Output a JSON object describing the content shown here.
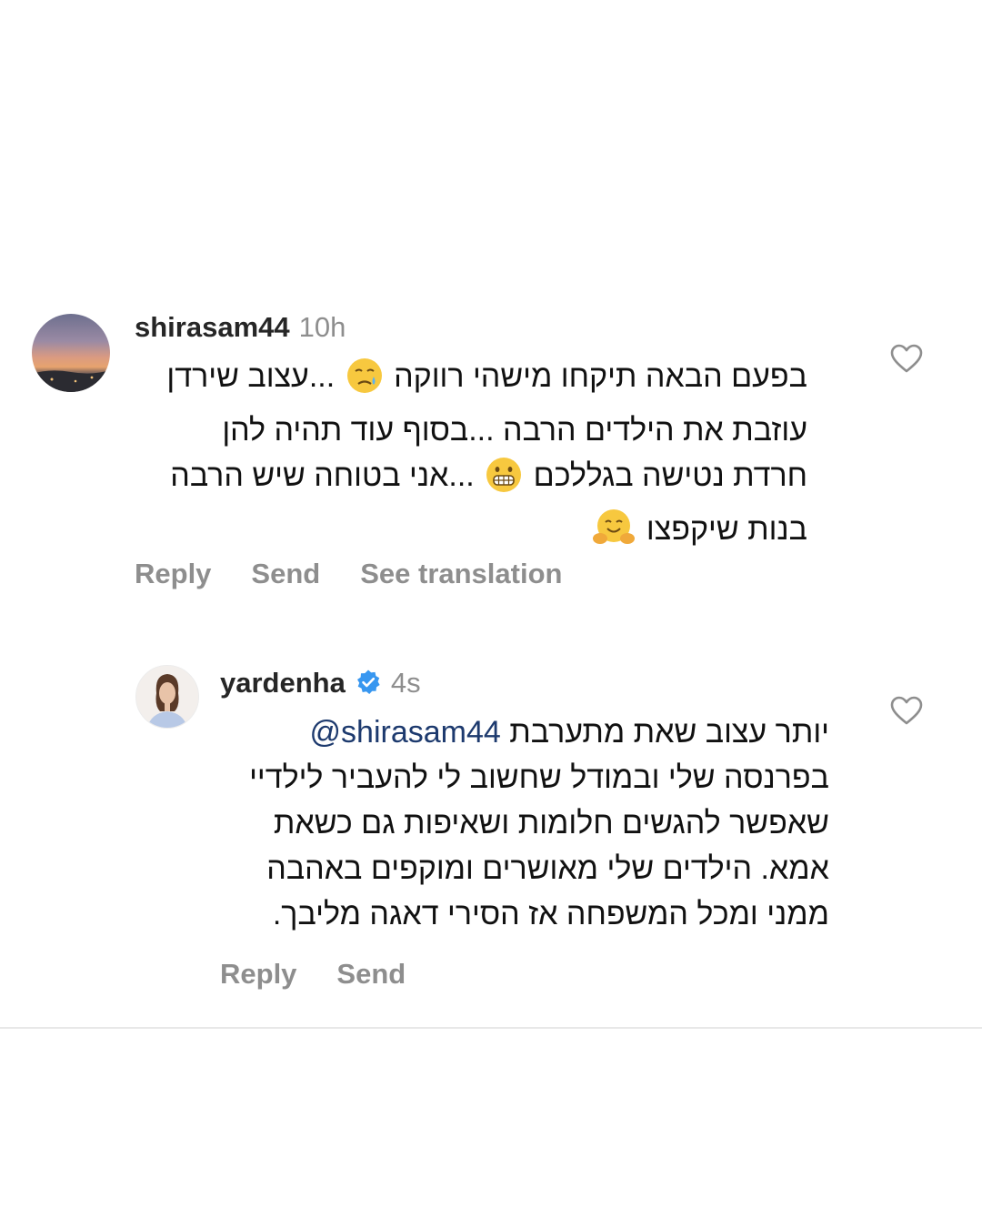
{
  "comments": [
    {
      "username": "shirasam44",
      "time": "10h",
      "lines": [
        {
          "before": "בפעם הבאה תיקחו מישהי רווקה",
          "emoji": "sad-tear-emoji",
          "after": "...עצוב שירדן"
        },
        {
          "text": "עוזבת את הילדים הרבה ...בסוף עוד תהיה להן"
        },
        {
          "before": "חרדת נטישה בגללכם",
          "emoji": "grimacing-emoji",
          "after": "...אני בטוחה שיש הרבה"
        },
        {
          "before": "בנות שיקפצו",
          "emoji": "hugging-emoji"
        }
      ],
      "actions": {
        "reply": "Reply",
        "send": "Send",
        "translate": "See translation"
      }
    },
    {
      "username": "yardenha",
      "verified": true,
      "time": "4s",
      "mention": "@shirasam44",
      "first_line": "יותר עצוב שאת מתערבת",
      "lines": [
        "בפרנסה שלי ובמודל שחשוב לי להעביר לילדיי",
        "שאפשר להגשים חלומות ושאיפות גם כשאת",
        "אמא. הילדים שלי מאושרים ומוקפים באהבה",
        "ממני ומכל המשפחה אז הסירי דאגה מליבך."
      ],
      "actions": {
        "reply": "Reply",
        "send": "Send"
      }
    }
  ],
  "icons": {
    "heart": "heart-outline-icon",
    "verified": "verified-badge-icon"
  },
  "colors": {
    "username": "#262626",
    "muted": "#8e8e8e",
    "verified": "#3897f0",
    "mention": "#1d3a6e"
  }
}
